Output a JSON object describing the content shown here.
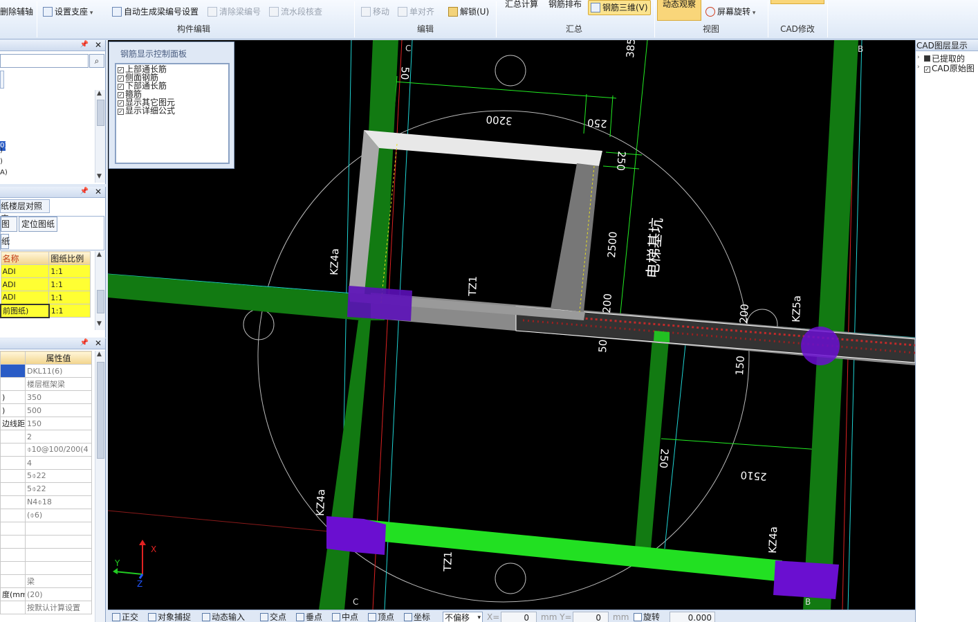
{
  "ribbon": {
    "buttons": {
      "delete_aux_axis": "删除辅轴",
      "set_support": "设置支座",
      "auto_beam_numbering": "自动生成梁编号设置",
      "clear_beam_numbering": "清除梁编号",
      "flow_segment_check": "流水段核查",
      "move": "移动",
      "single_align": "单对齐",
      "unlock": "解锁(U)",
      "summary_calc": "汇总计算",
      "rebar_layout": "钢筋排布",
      "rebar_3d": "钢筋三维(V)",
      "dynamic_view": "动态观察",
      "screen_rotate": "屏幕旋转"
    },
    "groups": {
      "component_edit": "构件编辑",
      "edit": "编辑",
      "summary": "汇总",
      "view": "视图",
      "cad_modify": "CAD修改"
    }
  },
  "rebar_panel": {
    "title": "钢筋显示控制面板",
    "options": [
      {
        "label": "上部通长筋",
        "checked": true
      },
      {
        "label": "侧面钢筋",
        "checked": true
      },
      {
        "label": "下部通长筋",
        "checked": true
      },
      {
        "label": "箍筋",
        "checked": true
      },
      {
        "label": "显示其它图元",
        "checked": true
      },
      {
        "label": "显示详细公式",
        "checked": true
      }
    ]
  },
  "left_top": {
    "items": [
      ")",
      ")",
      ")",
      "A)"
    ],
    "selected_item": "0)"
  },
  "drawing_panel": {
    "tab": "纸楼层对照表",
    "buttons": [
      "图纸",
      "定位图纸",
      "纸"
    ],
    "columns": [
      "名称",
      "图纸比例"
    ],
    "rows": [
      {
        "name": "ADI",
        "scale": "1:1"
      },
      {
        "name": "ADI",
        "scale": "1:1"
      },
      {
        "name": "ADI",
        "scale": "1:1"
      },
      {
        "name": "前图纸)",
        "scale": "1:1"
      }
    ]
  },
  "props_panel": {
    "header_value": "属性值",
    "rows": [
      {
        "name": "",
        "value": "DKL11(6)"
      },
      {
        "name": "",
        "value": "楼层框架梁"
      },
      {
        "name": ")",
        "value": "350"
      },
      {
        "name": ")",
        "value": "500"
      },
      {
        "name": "边线距",
        "value": "150"
      },
      {
        "name": "",
        "value": "2"
      },
      {
        "name": "",
        "value": "⌽10@100/200(4"
      },
      {
        "name": "",
        "value": "4"
      },
      {
        "name": "",
        "value": "5⌽22"
      },
      {
        "name": "",
        "value": "5⌽22"
      },
      {
        "name": "",
        "value": "N4⌽18"
      },
      {
        "name": "",
        "value": "(⌽6)"
      },
      {
        "name": "",
        "value": ""
      },
      {
        "name": "",
        "value": ""
      },
      {
        "name": "",
        "value": ""
      },
      {
        "name": "",
        "value": ""
      },
      {
        "name": "",
        "value": "梁"
      },
      {
        "name": "度(mm)",
        "value": "(20)"
      },
      {
        "name": "",
        "value": "按默认计算设置"
      }
    ]
  },
  "canvas": {
    "labels": {
      "kz4a_1": "KZ4a",
      "kz4a_2": "KZ4a",
      "kz4a_3": "KZ4a",
      "kz5a": "KZ5a",
      "tz1_1": "TZ1",
      "tz1_2": "TZ1",
      "pit": "电梯基坑",
      "axis_c_top": "C",
      "axis_c_bottom": "C",
      "axis_b_top": "B",
      "axis_b_bottom": "B"
    },
    "dims": {
      "d385": "385",
      "d50_top": "50",
      "d3200": "3200",
      "d250_a": "250",
      "d250_b": "250",
      "d2500": "2500",
      "d200_a": "200",
      "d200_b": "200",
      "d50_mid": "50",
      "d150": "150",
      "d250_c": "250",
      "d2510": "2510"
    },
    "ucs": {
      "x": "X",
      "y": "Y",
      "z": "Z"
    },
    "colors": {
      "column": "#127a12",
      "beam_bright": "#22e022",
      "slab": "#d8d8d8",
      "support": "#6a0fd0",
      "dim_line": "#22ee22",
      "axis_line": "#1fd4d4"
    }
  },
  "right_panel": {
    "title": "CAD图层显示",
    "items": [
      {
        "label": "已提取的",
        "checked": false
      },
      {
        "label": "CAD原始图",
        "checked": true
      }
    ]
  },
  "statusbar": {
    "items": [
      "正交",
      "对象捕捉",
      "动态输入",
      "交点",
      "垂点",
      "中点",
      "顶点",
      "坐标"
    ],
    "offset_mode": "不偏移",
    "x_label": "X=",
    "x_value": "0",
    "y_label": "mm Y=",
    "y_value": "0",
    "unit": "mm",
    "rotate_label": "旋转",
    "rotate_value": "0.000"
  }
}
